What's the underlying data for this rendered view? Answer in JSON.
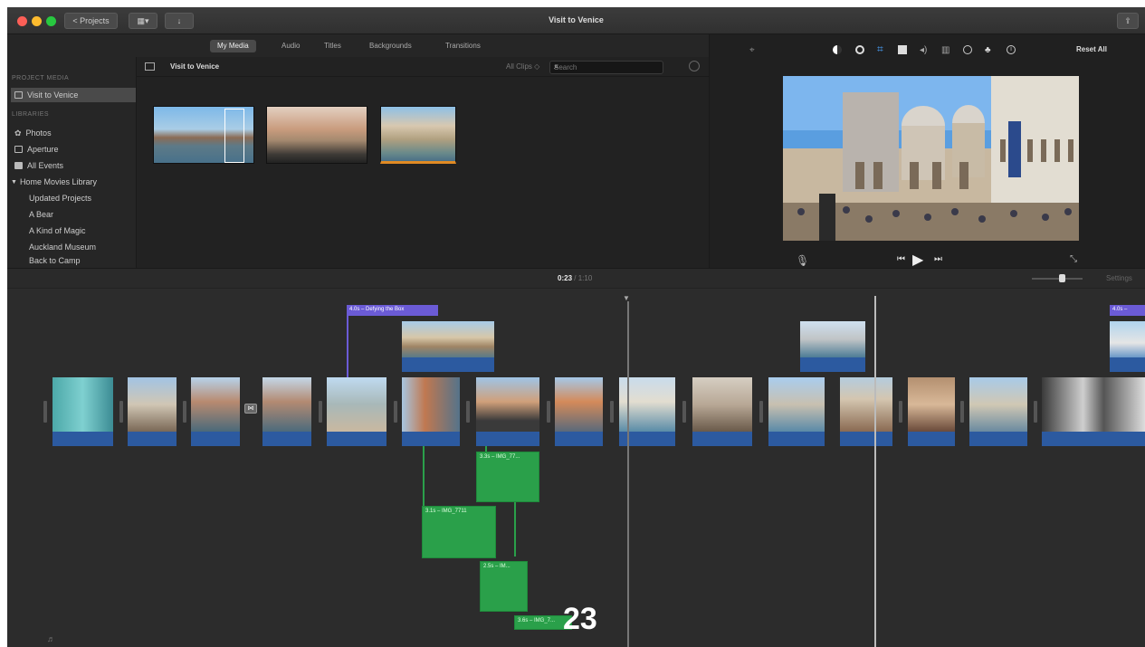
{
  "window": {
    "title": "Visit to Venice",
    "projects_button": "< Projects"
  },
  "tabs": [
    "My Media",
    "Audio",
    "Titles",
    "Backgrounds",
    "Transitions"
  ],
  "active_tab": 0,
  "sidebar": {
    "project_media_header": "PROJECT MEDIA",
    "project_item": "Visit to Venice",
    "libraries_header": "LIBRARIES",
    "libraries": [
      "Photos",
      "Aperture",
      "All Events"
    ],
    "home_library": "Home Movies Library",
    "events": [
      "Updated Projects",
      "A Bear",
      "A Kind of Magic",
      "Auckland Museum",
      "Back to Camp"
    ]
  },
  "browser": {
    "title": "Visit to Venice",
    "filter": "All Clips",
    "search_placeholder": "Search"
  },
  "viewer": {
    "reset_all": "Reset All"
  },
  "timeline": {
    "timecode_current": "0:23",
    "timecode_total": "/ 1:10",
    "settings_label": "Settings",
    "title_clip_1": "4.0s – Defying the Box",
    "title_clip_2": "4.0s –",
    "green_clip_1": "3.3s – IMG_77...",
    "green_clip_2": "3.1s – IMG_7711",
    "green_clip_3": "2.5s – IM...",
    "green_clip_4": "3.6s – IMG_7..."
  },
  "page_number": "23",
  "colors": {
    "audio_track": "#2c5aa0",
    "cutaway_clip": "#2aa04a",
    "title_clip": "#6b5bd6",
    "accent_tab": "#4a4a4a"
  }
}
